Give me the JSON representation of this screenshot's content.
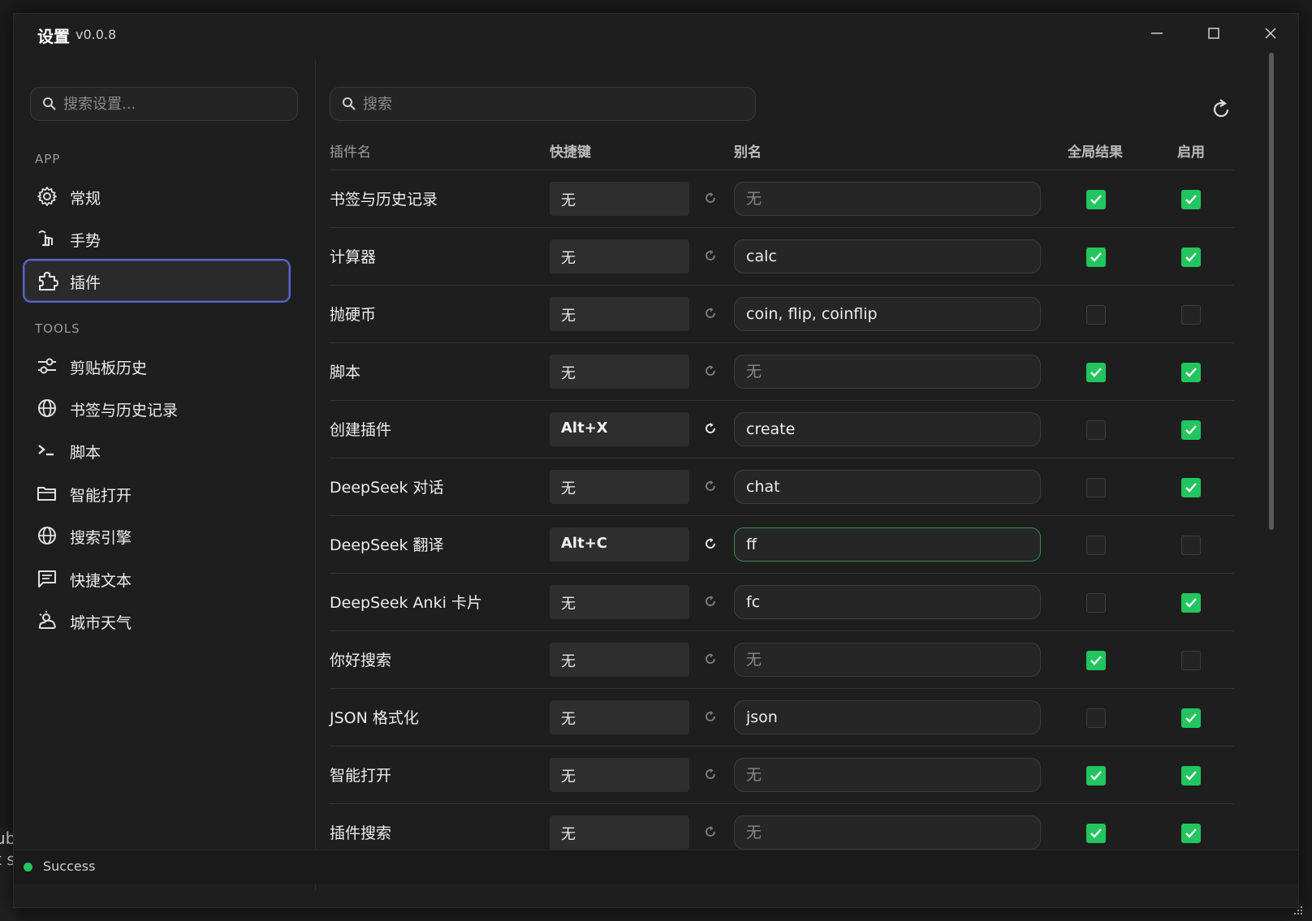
{
  "window": {
    "title": "设置",
    "version": "v0.0.8"
  },
  "sidebar": {
    "search_placeholder": "搜索设置...",
    "sections": {
      "app": "APP",
      "tools": "TOOLS"
    },
    "app_items": [
      {
        "label": "常规",
        "icon": "gear-icon"
      },
      {
        "label": "手势",
        "icon": "gesture-icon"
      },
      {
        "label": "插件",
        "icon": "puzzle-icon",
        "active": true
      }
    ],
    "tool_items": [
      {
        "label": "剪贴板历史",
        "icon": "sliders-icon"
      },
      {
        "label": "书签与历史记录",
        "icon": "globe-icon"
      },
      {
        "label": "脚本",
        "icon": "terminal-icon"
      },
      {
        "label": "智能打开",
        "icon": "folder-icon"
      },
      {
        "label": "搜索引擎",
        "icon": "globe-icon"
      },
      {
        "label": "快捷文本",
        "icon": "message-icon"
      },
      {
        "label": "城市天气",
        "icon": "weather-icon"
      }
    ]
  },
  "main": {
    "search_placeholder": "搜索",
    "columns": {
      "name": "插件名",
      "hotkey": "快捷键",
      "alias": "别名",
      "global": "全局结果",
      "enabled": "启用"
    },
    "alias_placeholder": "无",
    "rows": [
      {
        "name": "书签与历史记录",
        "hotkey": "无",
        "alias": "",
        "global": true,
        "enabled": true
      },
      {
        "name": "计算器",
        "hotkey": "无",
        "alias": "calc",
        "global": true,
        "enabled": true
      },
      {
        "name": "抛硬币",
        "hotkey": "无",
        "alias": "coin, flip, coinflip",
        "global": false,
        "enabled": false
      },
      {
        "name": "脚本",
        "hotkey": "无",
        "alias": "",
        "global": true,
        "enabled": true
      },
      {
        "name": "创建插件",
        "hotkey": "Alt+X",
        "alias": "create",
        "global": false,
        "enabled": true
      },
      {
        "name": "DeepSeek 对话",
        "hotkey": "无",
        "alias": "chat",
        "global": false,
        "enabled": true
      },
      {
        "name": "DeepSeek 翻译",
        "hotkey": "Alt+C",
        "alias": "ff",
        "global": false,
        "enabled": false,
        "focused": true
      },
      {
        "name": "DeepSeek Anki 卡片",
        "hotkey": "无",
        "alias": "fc",
        "global": false,
        "enabled": true
      },
      {
        "name": "你好搜索",
        "hotkey": "无",
        "alias": "",
        "global": true,
        "enabled": false
      },
      {
        "name": "JSON 格式化",
        "hotkey": "无",
        "alias": "json",
        "global": false,
        "enabled": true
      },
      {
        "name": "智能打开",
        "hotkey": "无",
        "alias": "",
        "global": true,
        "enabled": true
      },
      {
        "name": "插件搜索",
        "hotkey": "无",
        "alias": "",
        "global": true,
        "enabled": true
      }
    ]
  },
  "status": {
    "text": "Success",
    "color": "#22c55e"
  },
  "background_peek": [
    "ub",
    "t s"
  ],
  "colors": {
    "accent_active": "#5866c8",
    "check_on": "#22c55e"
  }
}
